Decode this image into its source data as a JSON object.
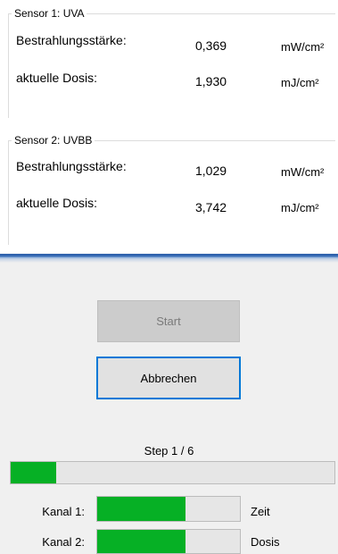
{
  "sensors": [
    {
      "title": "Sensor 1: UVA",
      "irradiance_label": "Bestrahlungsstärke:",
      "irradiance_value": "0,369",
      "irradiance_unit": "mW/cm²",
      "dose_label": "aktuelle Dosis:",
      "dose_value": "1,930",
      "dose_unit": "mJ/cm²"
    },
    {
      "title": "Sensor 2: UVBB",
      "irradiance_label": "Bestrahlungsstärke:",
      "irradiance_value": "1,029",
      "irradiance_unit": "mW/cm²",
      "dose_label": "aktuelle Dosis:",
      "dose_value": "3,742",
      "dose_unit": "mJ/cm²"
    }
  ],
  "controls": {
    "start_label": "Start",
    "cancel_label": "Abbrechen"
  },
  "progress": {
    "step_label": "Step 1 / 6",
    "step_fraction": 0.14,
    "channels": [
      {
        "label": "Kanal 1:",
        "after_label": "Zeit",
        "fraction": 0.62
      },
      {
        "label": "Kanal 2:",
        "after_label": "Dosis",
        "fraction": 0.62
      }
    ]
  },
  "colors": {
    "progress_fill": "#06b025",
    "focus_border": "#0078d7",
    "separator_blue": "#2b5ea7"
  }
}
